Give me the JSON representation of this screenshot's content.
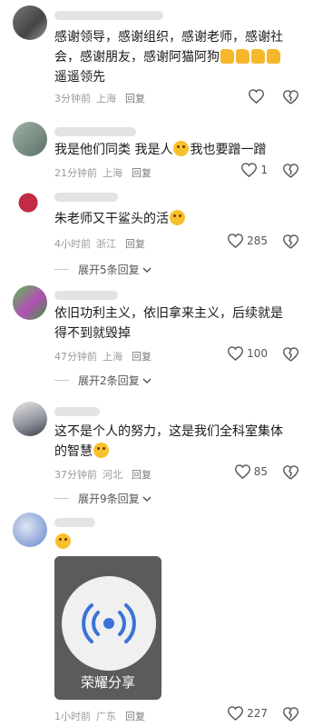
{
  "comments": [
    {
      "id": "c1",
      "lines": [
        "感谢领导，感谢组织，感谢老师，感谢社",
        "会，感谢朋友，感谢阿猫阿狗",
        "遥遥领先"
      ],
      "time": "3分钟前",
      "location": "上海",
      "reply": "回复",
      "likes": ""
    },
    {
      "id": "c2",
      "text_a": "我是他们同类 我是人",
      "text_b": "我也要蹭一蹭",
      "time": "21分钟前",
      "location": "上海",
      "reply": "回复",
      "likes": "1"
    },
    {
      "id": "c3",
      "text": "朱老师又干鲨头的活",
      "time": "4小时前",
      "location": "浙江",
      "reply": "回复",
      "likes": "285",
      "expand": "展开5条回复"
    },
    {
      "id": "c4",
      "lines": [
        "依旧功利主义，依旧拿来主义，后续就是",
        "得不到就毁掉"
      ],
      "time": "47分钟前",
      "location": "上海",
      "reply": "回复",
      "likes": "100",
      "expand": "展开2条回复"
    },
    {
      "id": "c5",
      "lines": [
        "这不是个人的努力，这是我们全科室集体",
        "的智慧"
      ],
      "time": "37分钟前",
      "location": "河北",
      "reply": "回复",
      "likes": "85",
      "expand": "展开9条回复"
    },
    {
      "id": "c6",
      "card_label": "荣耀分享",
      "time": "1小时前",
      "location": "广东",
      "reply": "回复",
      "likes": "227"
    }
  ],
  "icons": {
    "like": "heart-outline-icon",
    "dislike": "broken-heart-icon",
    "expand": "chevron-down-icon"
  },
  "colors": {
    "meta": "#9a9a9a",
    "emoji": "#f7c12a",
    "share_icon": "#3a72d8"
  }
}
